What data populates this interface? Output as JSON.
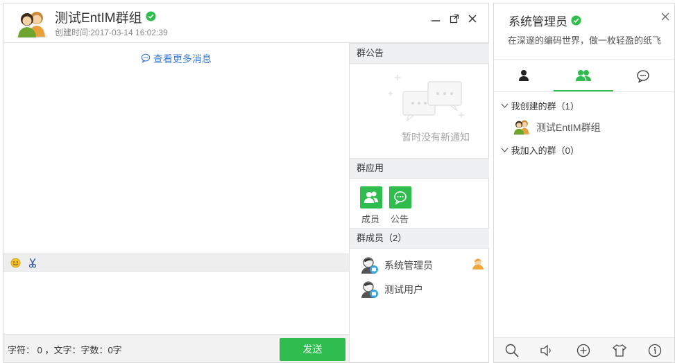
{
  "chat": {
    "group_name": "测试EntIM群组",
    "created_label": "创建时间:",
    "created_time": "2017-03-14 16:02:39",
    "more_messages": "查看更多消息",
    "char_count": "字符： 0 ，文字：字数：0字",
    "send_label": "发送",
    "window_controls": [
      "minimize-icon",
      "maximize-icon",
      "close-icon"
    ]
  },
  "side": {
    "notice_title": "群公告",
    "notice_empty": "暂时没有新通知",
    "apps_title": "群应用",
    "apps": [
      {
        "label": "成员",
        "icon": "members-icon"
      },
      {
        "label": "公告",
        "icon": "chat-bubble-icon"
      }
    ],
    "members_title": "群成员（2）",
    "members": [
      {
        "name": "系统管理员"
      },
      {
        "name": "测试用户"
      }
    ]
  },
  "contacts": {
    "user_name": "系统管理员",
    "signature": "在深邃的编码世界，做一枚轻盈的纸飞",
    "tabs": [
      "person-icon",
      "group-icon",
      "chat-icon"
    ],
    "active_tab": 1,
    "tree": {
      "created": "我创建的群（1）",
      "joined": "我加入的群（0）",
      "created_groups": [
        {
          "name": "测试EntIM群组"
        }
      ]
    },
    "bottom_icons": [
      "search-icon",
      "volume-icon",
      "add-icon",
      "skin-icon",
      "info-icon"
    ]
  },
  "colors": {
    "accent": "#2fbd4e",
    "link": "#3d7bd1",
    "verified": "#2fbd4e"
  }
}
